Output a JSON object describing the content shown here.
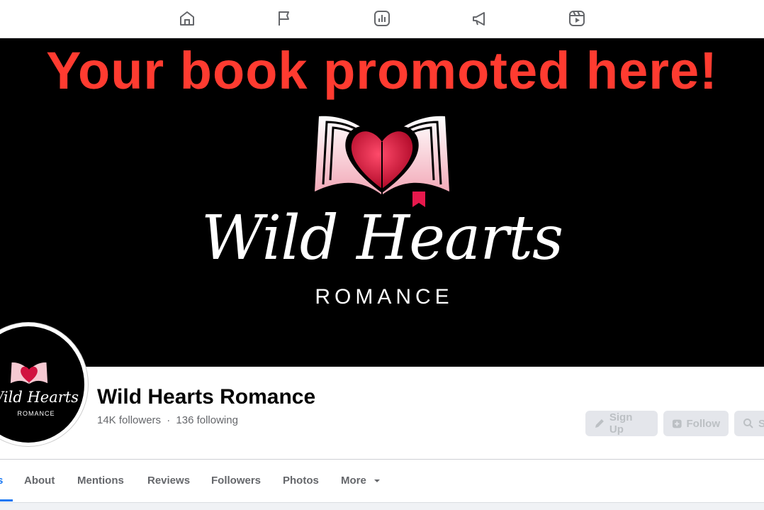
{
  "topnav": {
    "icons": [
      "home-icon",
      "flag-icon",
      "insights-icon",
      "megaphone-icon",
      "reels-icon"
    ]
  },
  "cover": {
    "promo_text": "Your book promoted here!",
    "brand_script": "Wild Hearts",
    "brand_sub": "ROMANCE"
  },
  "avatar": {
    "script": "Wild Hearts",
    "sub": "ROMANCE"
  },
  "profile": {
    "name": "Wild Hearts Romance",
    "followers": "14K followers",
    "separator": "·",
    "following": "136 following"
  },
  "actions": {
    "signup": "Sign Up",
    "follow": "Follow",
    "search": "S"
  },
  "tabs": {
    "first_partial": "s",
    "about": "About",
    "mentions": "Mentions",
    "reviews": "Reviews",
    "followers": "Followers",
    "photos": "Photos",
    "more": "More"
  },
  "colors": {
    "accent": "#1877f2",
    "promo": "#ff3b30",
    "heart": "#d1123f"
  }
}
